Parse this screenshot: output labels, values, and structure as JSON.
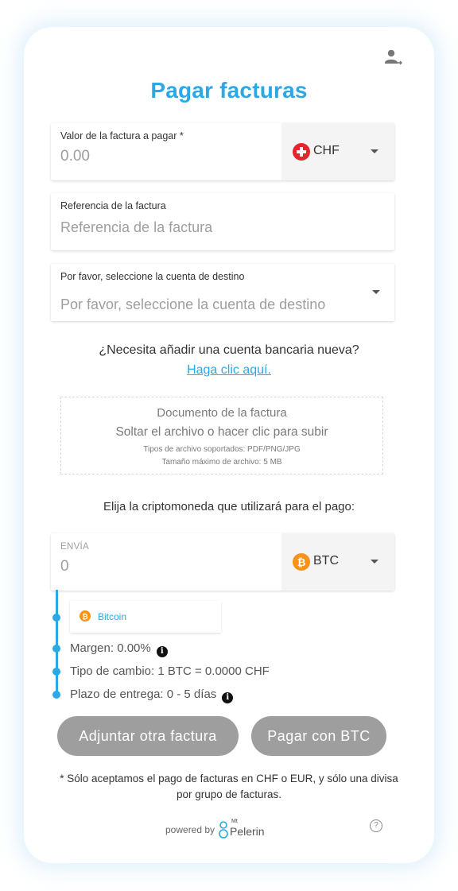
{
  "header": {
    "title": "Pagar facturas"
  },
  "invoice_amount": {
    "label": "Valor de la factura a pagar *",
    "placeholder": "0.00",
    "currency": "CHF"
  },
  "reference": {
    "label": "Referencia de la factura",
    "placeholder": "Referencia de la factura"
  },
  "destination": {
    "label": "Por favor, seleccione la cuenta de destino",
    "placeholder": "Por favor, seleccione la cuenta de destino"
  },
  "bank": {
    "question": "¿Necesita añadir una cuenta bancaria nueva?",
    "link": "Haga clic aquí."
  },
  "upload": {
    "title": "Documento de la factura",
    "instruction": "Soltar el archivo o hacer clic para subir",
    "types": "Tipos de archivo soportados: PDF/PNG/JPG",
    "max_size": "Tamaño máximo de archivo: 5 MB"
  },
  "crypto": {
    "prompt": "Elija la criptomoneda que utilizará para el pago:"
  },
  "send": {
    "label": "ENVÍA",
    "value": "0",
    "currency": "BTC"
  },
  "coin": {
    "name": "Bitcoin"
  },
  "details": {
    "margin": "Margen: 0.00%",
    "rate": "Tipo de cambio: 1 BTC = 0.0000 CHF",
    "delivery": "Plazo de entrega: 0 - 5 días"
  },
  "buttons": {
    "attach": "Adjuntar otra factura",
    "pay": "Pagar con BTC"
  },
  "note": "* Sólo aceptamos el pago de facturas en CHF o EUR, y sólo una divisa por grupo de facturas.",
  "footer": {
    "powered": "powered by",
    "brand_small": "Mt",
    "brand": "Pelerin"
  },
  "colors": {
    "accent": "#2aa9e6",
    "button": "#9e9e9e",
    "bitcoin": "#f7931a",
    "swiss_red": "#e3262c"
  },
  "icons": [
    "user-switch-icon",
    "swiss-flag-icon",
    "chevron-down-icon",
    "bitcoin-icon",
    "info-icon",
    "help-icon"
  ]
}
